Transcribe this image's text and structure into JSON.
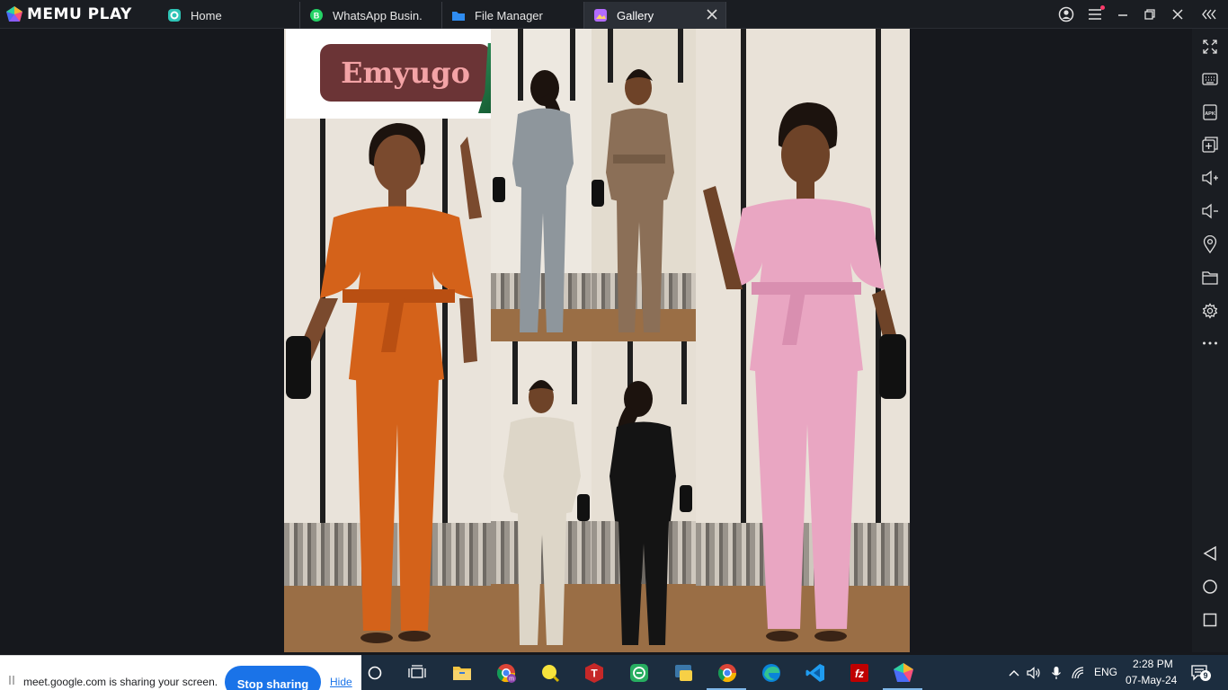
{
  "titlebar": {
    "logo_text": "MEMU PLAY",
    "tabs": [
      {
        "label": "Home",
        "icon": "home-app-icon"
      },
      {
        "label": "WhatsApp Busin.",
        "icon": "whatsapp-business-icon"
      },
      {
        "label": "File Manager",
        "icon": "folder-icon"
      },
      {
        "label": "Gallery",
        "icon": "gallery-icon",
        "active": true
      }
    ],
    "window_buttons": [
      "account-icon",
      "menu-icon",
      "minimize-icon",
      "restore-icon",
      "close-icon",
      "collapse-sidebar-icon"
    ]
  },
  "sidebar": {
    "buttons": [
      "fullscreen-icon",
      "keyboard-icon",
      "apk-icon",
      "multi-instance-icon",
      "volume-up-icon",
      "volume-down-icon",
      "location-icon",
      "shared-folder-icon",
      "settings-icon",
      "more-icon"
    ],
    "apk_label": "APK",
    "nav": [
      "back-icon",
      "home-icon",
      "recents-icon"
    ]
  },
  "gallery": {
    "brand_text": "Emyugo",
    "colors": {
      "orange": "#d4621a",
      "grey": "#8e969c",
      "brown": "#8b6f57",
      "pink": "#e9a6c2",
      "cream": "#ddd6c8",
      "black": "#141414",
      "brand_pill": "#6b3436",
      "brand_text": "#f3a3a6"
    }
  },
  "sharebar": {
    "message": "meet.google.com is sharing your screen.",
    "stop_label": "Stop sharing",
    "hide_label": "Hide"
  },
  "taskbar": {
    "apps": [
      "task-view-icon",
      "file-explorer-icon",
      "chrome-profile-icon",
      "yellow-app-icon",
      "t-app-icon",
      "green-app-icon",
      "python-icon",
      "chrome-icon",
      "edge-icon",
      "vscode-icon",
      "filezilla-icon",
      "memu-icon"
    ],
    "tray": {
      "language": "ENG",
      "time": "2:28 PM",
      "date": "07-May-24",
      "notifications": "9"
    }
  }
}
